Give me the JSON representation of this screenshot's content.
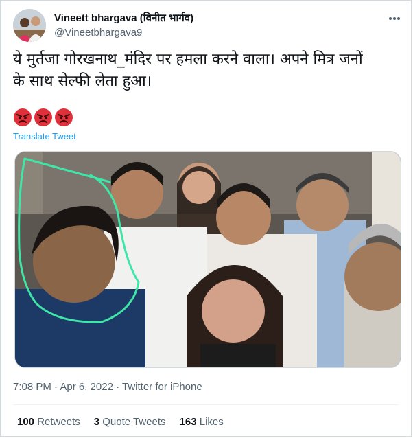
{
  "author": {
    "display_name": "Vineett bhargava (विनीत भार्गव)",
    "handle": "@Vineetbhargava9"
  },
  "tweet": {
    "text_line1": "ये मुर्तजा गोरखनाथ_मंदिर पर हमला करने वाला। अपने मित्र जनों",
    "text_line2": "के साथ सेल्फी लेता हुआ।",
    "reaction_icons": [
      "angry-face-icon",
      "angry-face-icon",
      "angry-face-icon"
    ],
    "translate_label": "Translate Tweet",
    "meta": "7:08 PM · Apr 6, 2022 · Twitter for iPhone"
  },
  "stats": [
    {
      "count": "100",
      "label": "Retweets"
    },
    {
      "count": "3",
      "label": "Quote Tweets"
    },
    {
      "count": "163",
      "label": "Likes"
    }
  ],
  "colors": {
    "link": "#1d9bf0",
    "secondary_text": "#536471",
    "highlight_marker": "#3ee6a8",
    "emoji_red": "#e0303a"
  }
}
